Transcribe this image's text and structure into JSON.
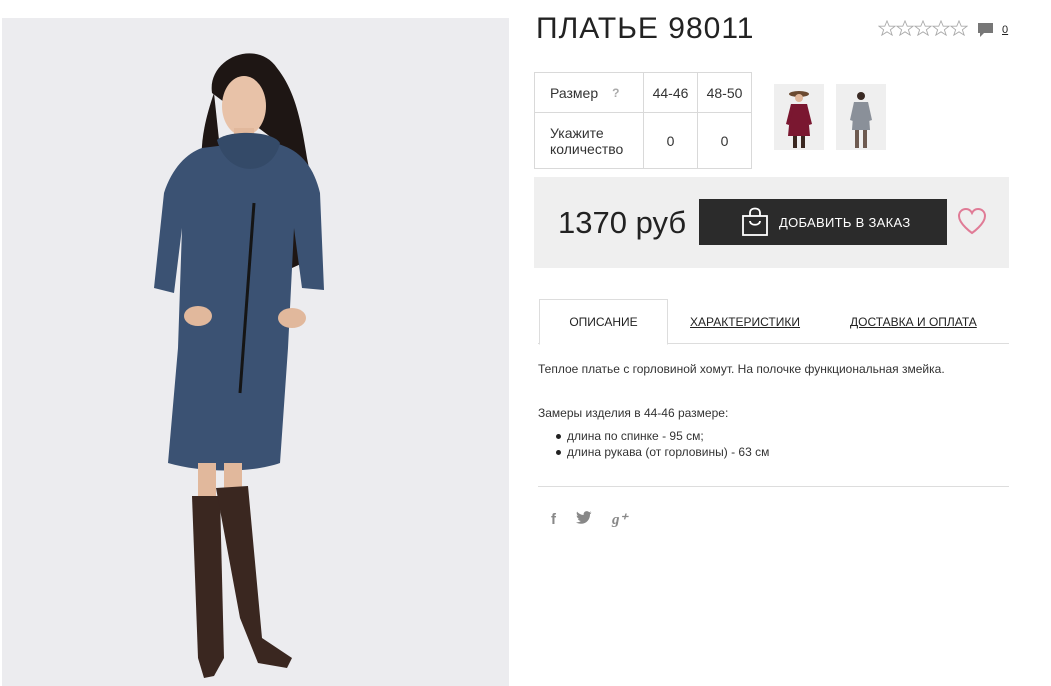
{
  "product": {
    "title": "ПЛАТЬЕ 98011",
    "rating_stars": 0,
    "rating_max": 5,
    "comments_count": "0",
    "price": "1370 руб",
    "add_to_order_label": "ДОБАВИТЬ В ЗАКАЗ"
  },
  "size_table": {
    "size_label": "Размер",
    "help": "?",
    "sizes": [
      "44-46",
      "48-50"
    ],
    "quantity_label": "Укажите количество",
    "quantities": [
      "0",
      "0"
    ]
  },
  "color_thumbnails": [
    {
      "name": "burgundy",
      "color": "#7a1730"
    },
    {
      "name": "grey",
      "color": "#8a9099"
    }
  ],
  "tabs": [
    {
      "label": "ОПИСАНИЕ",
      "active": true
    },
    {
      "label": "ХАРАКТЕРИСТИКИ",
      "active": false
    },
    {
      "label": "ДОСТАВКА И ОПЛАТА",
      "active": false
    }
  ],
  "description": {
    "text": "Теплое платье с горловиной хомут. На полочке функциональная змейка.",
    "measures_title": "Замеры изделия в 44-46 размере:",
    "measures": [
      "длина по спинке - 95 см;",
      "длина рукава (от горловины) - 63 см"
    ]
  },
  "social": [
    {
      "name": "facebook-icon",
      "glyph": "f"
    },
    {
      "name": "twitter-icon",
      "glyph": "t"
    },
    {
      "name": "google-plus-icon",
      "glyph": "g⁺"
    }
  ],
  "colors": {
    "dress": "#3b5273",
    "button": "#2b2b2b",
    "heart": "#e07b96",
    "price_bg": "#efefef"
  }
}
